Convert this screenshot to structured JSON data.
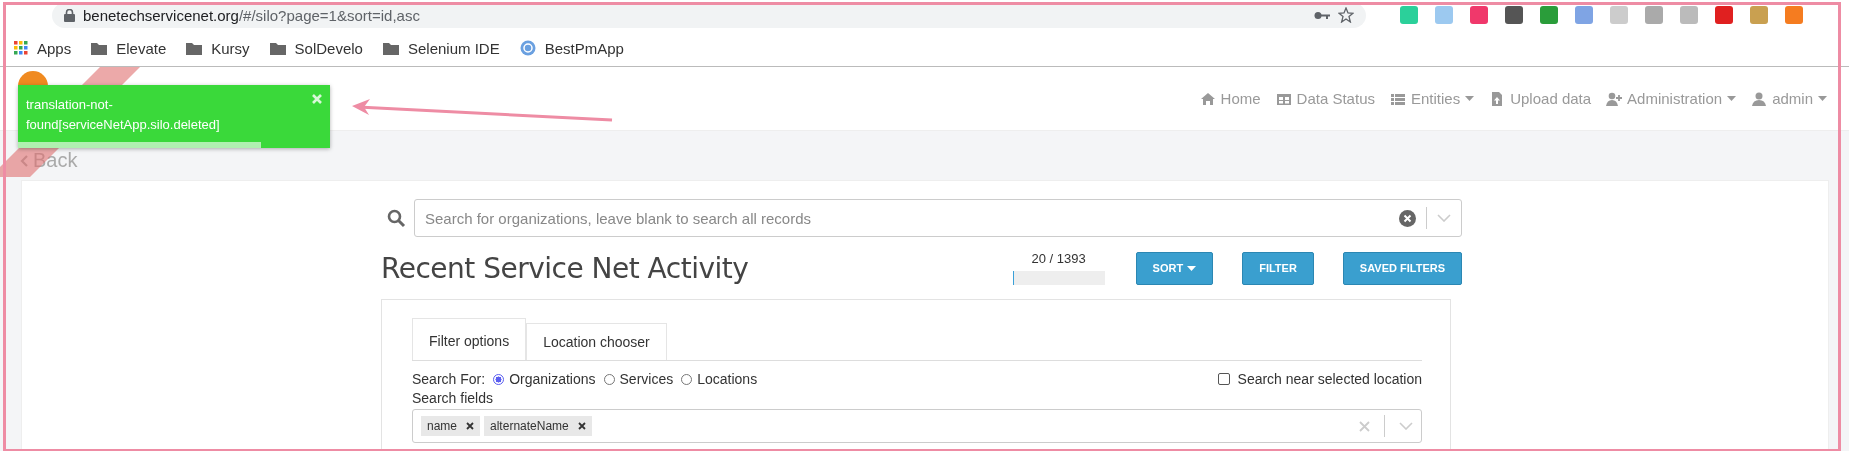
{
  "browser": {
    "url_host": "benetechservicenet.org",
    "url_path": "/#/silo?page=1&sort=id,asc",
    "bookmarks": [
      {
        "label": "Apps",
        "kind": "apps"
      },
      {
        "label": "Elevate",
        "kind": "folder"
      },
      {
        "label": "Kursy",
        "kind": "folder"
      },
      {
        "label": "SolDevelo",
        "kind": "folder"
      },
      {
        "label": "Selenium IDE",
        "kind": "folder"
      },
      {
        "label": "BestPmApp",
        "kind": "site"
      }
    ]
  },
  "toast": {
    "text": "translation-not-found[serviceNetApp.silo.deleted]",
    "level": 0.78
  },
  "nav": [
    {
      "label": "Home",
      "dropdown": false
    },
    {
      "label": "Data Status",
      "dropdown": false
    },
    {
      "label": "Entities",
      "dropdown": true
    },
    {
      "label": "Upload data",
      "dropdown": false
    },
    {
      "label": "Administration",
      "dropdown": true
    },
    {
      "label": "admin",
      "dropdown": true
    }
  ],
  "back": "Back",
  "search": {
    "placeholder": "Search for organizations, leave blank to search all records"
  },
  "title": "Recent Service Net Activity",
  "count": "20 / 1393",
  "progress": {
    "level": 0.01
  },
  "buttons": [
    {
      "label": "SORT",
      "dropdown": true
    },
    {
      "label": "FILTER",
      "dropdown": false
    },
    {
      "label": "SAVED FILTERS",
      "dropdown": false
    }
  ],
  "tabs": [
    {
      "label": "Filter options",
      "selected": true
    },
    {
      "label": "Location chooser",
      "selected": false
    }
  ],
  "search_for": {
    "label": "Search For:",
    "options": [
      {
        "label": "Organizations",
        "selected": true
      },
      {
        "label": "Services",
        "selected": false
      },
      {
        "label": "Locations",
        "selected": false
      }
    ]
  },
  "near": {
    "label": "Search near selected location",
    "checked": false
  },
  "search_fields": {
    "label": "Search fields",
    "tags": [
      "name",
      "alternateName"
    ]
  }
}
